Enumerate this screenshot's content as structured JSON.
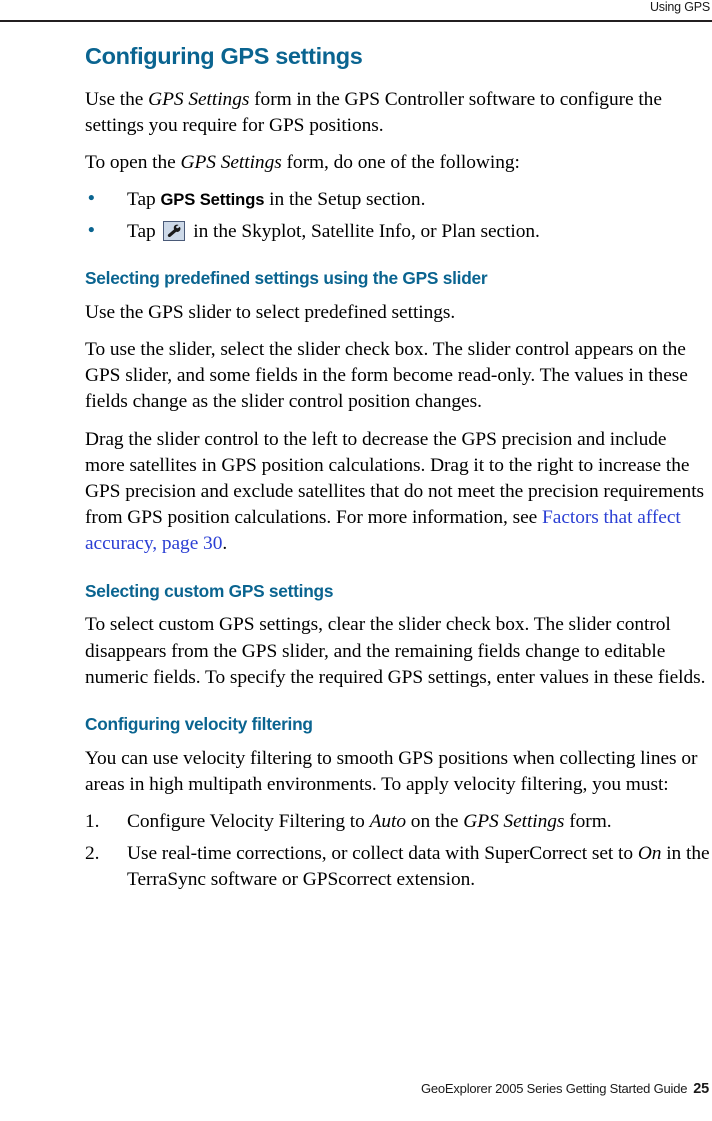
{
  "header": {
    "running_head": "Using GPS"
  },
  "footer": {
    "guide_title": "GeoExplorer 2005 Series Getting Started Guide",
    "page_number": "25"
  },
  "colors": {
    "heading": "#0a6490",
    "link": "#2b3fd4",
    "rule": "#231f20",
    "icon_button_fill": "#cdd9e8",
    "icon_button_border": "#4a5a78"
  },
  "sections": {
    "configuring_gps_settings": {
      "title": "Configuring GPS settings",
      "intro_p1_a": "Use the ",
      "intro_p1_em": "GPS Settings",
      "intro_p1_b": " form in the GPS Controller software to configure the settings you require for GPS positions.",
      "intro_p2_a": "To open the ",
      "intro_p2_em": "GPS Settings",
      "intro_p2_b": " form, do one of the following:",
      "bullets": [
        {
          "marker": "•",
          "pre": "Tap ",
          "ui_label": "GPS Settings",
          "post": " in the Setup section."
        },
        {
          "marker": "•",
          "pre": "Tap ",
          "icon": "wrench-icon",
          "post": " in the Skyplot, Satellite Info, or Plan section."
        }
      ]
    },
    "predefined_settings": {
      "title": "Selecting predefined settings using the GPS slider",
      "p1": "Use the GPS slider to select predefined settings.",
      "p2": "To use the slider, select the slider check box. The slider control appears on the GPS slider, and some fields in the form become read-only. The values in these fields change as the slider control position changes.",
      "p3_a": "Drag the slider control to the left to decrease the GPS precision and include more satellites in GPS position calculations. Drag it to the right to increase the GPS precision and exclude satellites that do not meet the precision requirements from GPS position calculations. For more information, see ",
      "p3_link_title": "Factors that affect accuracy",
      "p3_link_sep": ", ",
      "p3_link_page": "page 30",
      "p3_end": "."
    },
    "custom_settings": {
      "title": "Selecting custom GPS settings",
      "p1": "To select custom GPS settings, clear the slider check box. The slider control disappears from the GPS slider, and the remaining fields change to editable numeric fields. To specify the required GPS settings, enter values in these fields."
    },
    "velocity_filtering": {
      "title": "Configuring velocity filtering",
      "p1": "You can use velocity filtering to smooth GPS positions when collecting lines or areas in high multipath environments. To apply velocity filtering, you must:",
      "steps": [
        {
          "marker": "1.",
          "a": "Configure Velocity Filtering to ",
          "em1": "Auto",
          "b": " on the ",
          "em2": "GPS Settings",
          "c": " form."
        },
        {
          "marker": "2.",
          "a": "Use real-time corrections, or collect data with SuperCorrect set to ",
          "em1": "On",
          "b": " in the TerraSync software or GPScorrect extension.",
          "em2": "",
          "c": ""
        }
      ]
    }
  }
}
